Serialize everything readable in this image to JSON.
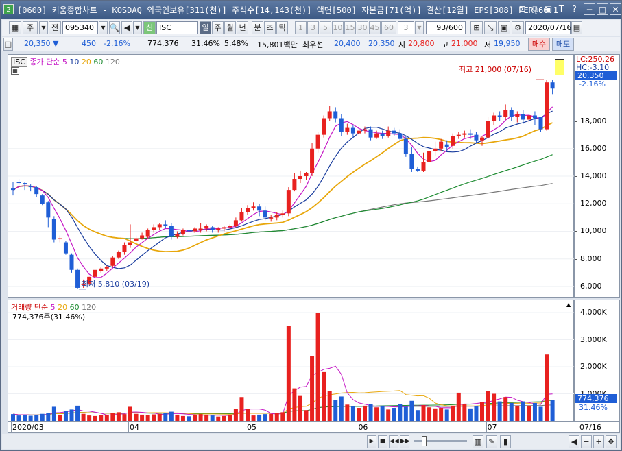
{
  "window": {
    "title": "[0600] 키움종합차트 - KOSDAQ 외국인보유[311(천)] 주식수[14,143(천)] 액면[500] 자본금[71(억)] 결산[12월] EPS[308] PER[66.1",
    "icon_label": "2",
    "buttons": [
      "⊡",
      "⧉",
      "▣",
      "T",
      "?",
      "─",
      "□",
      "✕"
    ]
  },
  "toolbar": {
    "period_label": "주",
    "prev_label": "전",
    "code_value": "095340",
    "sin_label": "신",
    "name_value": "ISC",
    "period_tabs": [
      "일",
      "주",
      "월",
      "년",
      "분",
      "초",
      "틱"
    ],
    "minute_tabs": [
      "1",
      "3",
      "5",
      "10",
      "15",
      "30",
      "45",
      "60"
    ],
    "custom_value": "3",
    "count_value": "93/600",
    "date_value": "2020/07/16"
  },
  "quote": {
    "price": "20,350",
    "arrow": "▼",
    "change": "450",
    "change_pct": "-2.16%",
    "volume": "774,376",
    "vol_ratio": "31.46%",
    "turnover": "5.48%",
    "amount": "15,801백만",
    "ask_label": "최우선",
    "ask": "20,400",
    "bid": "20,350",
    "open_label": "시",
    "open": "20,800",
    "high_label": "고",
    "high": "21,000",
    "low_label": "저",
    "low": "19,950",
    "buy_label": "매수",
    "sell_label": "매도"
  },
  "price_legend": {
    "symbol": "ISC",
    "label": "종가 단순",
    "periods": [
      "5",
      "10",
      "20",
      "60",
      "120"
    ]
  },
  "volume_legend": {
    "label": "거래량 단순",
    "periods": [
      "5",
      "20",
      "60",
      "120"
    ],
    "current": "774,376주(31.46%)"
  },
  "annotations": {
    "high": "최고 21,000 (07/16)",
    "low": "최저 5,810 (03/19)",
    "lc": "LC:250.26",
    "hc": "HC:-3.10"
  },
  "price_axis": {
    "ticks": [
      "18,000",
      "16,000",
      "14,000",
      "12,000",
      "10,000",
      "8,000",
      "6,000"
    ],
    "current": "20,350",
    "current_pct": "-2.16%"
  },
  "volume_axis": {
    "ticks": [
      "4,000K",
      "3,000K",
      "2,000K",
      "1,000K"
    ],
    "current": "774,376",
    "current_pct": "31.46%"
  },
  "x_axis": {
    "labels": [
      "2020/03",
      "04",
      "05",
      "06",
      "07"
    ],
    "right_label": "07/16"
  },
  "colors": {
    "up": "#e8211f",
    "down": "#1f5ed6",
    "ma5": "#c517c5",
    "ma10": "#1a3d9e",
    "ma20": "#e8a70c",
    "ma60": "#1e8c32",
    "ma120": "#777777"
  },
  "chart_data": {
    "type": "candlestick",
    "symbol": "ISC",
    "price_ylim": [
      5400,
      22500
    ],
    "volume_ylim": [
      0,
      4000000
    ],
    "candles": [
      [
        13100,
        13600,
        13000,
        12600
      ],
      [
        13600,
        13800,
        13500,
        13300
      ],
      [
        13500,
        13600,
        13400,
        13000
      ],
      [
        13300,
        13400,
        13200,
        12900
      ],
      [
        13200,
        13300,
        12700,
        12500
      ],
      [
        12600,
        12700,
        12000,
        11900
      ],
      [
        12100,
        12200,
        11000,
        10300
      ],
      [
        10900,
        11100,
        9400,
        9200
      ],
      [
        9500,
        9700,
        9500,
        9200
      ],
      [
        9200,
        9300,
        8400,
        8300
      ],
      [
        8300,
        8400,
        7200,
        7000
      ],
      [
        7200,
        7300,
        5900,
        5810
      ],
      [
        6100,
        6500,
        6200,
        5900
      ],
      [
        6200,
        6700,
        6700,
        6100
      ],
      [
        6700,
        7000,
        7200,
        6800
      ],
      [
        7100,
        7400,
        7300,
        7000
      ],
      [
        7300,
        7500,
        7400,
        7100
      ],
      [
        7500,
        8200,
        8100,
        7400
      ],
      [
        8100,
        8600,
        8500,
        8000
      ],
      [
        8500,
        9200,
        9000,
        8300
      ],
      [
        9000,
        10500,
        9200,
        8800
      ],
      [
        9300,
        9700,
        9500,
        9200
      ],
      [
        9500,
        9900,
        9700,
        9400
      ],
      [
        9600,
        10200,
        10100,
        9500
      ],
      [
        10100,
        10500,
        10300,
        9900
      ],
      [
        10300,
        10600,
        10500,
        10100
      ],
      [
        10500,
        10800,
        10400,
        10200
      ],
      [
        10400,
        10600,
        9600,
        9400
      ],
      [
        9600,
        10000,
        9800,
        9500
      ],
      [
        9800,
        10200,
        10100,
        9700
      ],
      [
        10100,
        10300,
        10000,
        9800
      ],
      [
        10000,
        10300,
        10200,
        9900
      ],
      [
        10100,
        10600,
        10200,
        9900
      ],
      [
        10200,
        10500,
        10400,
        10000
      ],
      [
        10300,
        10400,
        10100,
        9900
      ],
      [
        10100,
        10300,
        10200,
        9900
      ],
      [
        10200,
        10400,
        10300,
        10000
      ],
      [
        10300,
        10500,
        10400,
        10100
      ],
      [
        10400,
        11000,
        10800,
        10300
      ],
      [
        10800,
        11700,
        11400,
        10700
      ],
      [
        11400,
        11900,
        11700,
        11200
      ],
      [
        11700,
        12100,
        11800,
        11500
      ],
      [
        11800,
        12000,
        11500,
        11100
      ],
      [
        11500,
        11800,
        11000,
        10800
      ],
      [
        11000,
        11200,
        11000,
        10700
      ],
      [
        11000,
        11400,
        11200,
        10800
      ],
      [
        11200,
        11500,
        11300,
        11000
      ],
      [
        11300,
        13200,
        13000,
        11100
      ],
      [
        13000,
        14200,
        13800,
        12900
      ],
      [
        13800,
        14400,
        14000,
        13500
      ],
      [
        14000,
        14300,
        14200,
        13700
      ],
      [
        14200,
        16400,
        16000,
        14000
      ],
      [
        16000,
        17200,
        17000,
        15700
      ],
      [
        17000,
        18400,
        18200,
        16800
      ],
      [
        18200,
        19100,
        18700,
        18000
      ],
      [
        18700,
        19000,
        18200,
        17900
      ],
      [
        18200,
        18500,
        17200,
        16900
      ],
      [
        17200,
        17800,
        17500,
        17000
      ],
      [
        17500,
        17700,
        17100,
        16800
      ],
      [
        17100,
        17400,
        17300,
        16900
      ],
      [
        17300,
        17600,
        17400,
        17100
      ],
      [
        17400,
        17600,
        16800,
        16600
      ],
      [
        16800,
        17300,
        17100,
        16700
      ],
      [
        17100,
        17300,
        16900,
        16700
      ],
      [
        16900,
        17600,
        17300,
        16800
      ],
      [
        17300,
        17500,
        17100,
        16900
      ],
      [
        17100,
        17400,
        16700,
        16500
      ],
      [
        16700,
        16900,
        15600,
        15400
      ],
      [
        15600,
        16100,
        14500,
        14300
      ],
      [
        14500,
        14700,
        14400,
        14300
      ],
      [
        14400,
        15700,
        15000,
        14300
      ],
      [
        15000,
        15700,
        15800,
        15300
      ],
      [
        15800,
        16500,
        16000,
        15500
      ],
      [
        16000,
        16700,
        16500,
        15800
      ],
      [
        16300,
        16600,
        16100,
        15800
      ],
      [
        16200,
        17100,
        16900,
        16000
      ],
      [
        16900,
        17200,
        17000,
        16700
      ],
      [
        17000,
        17300,
        17100,
        16800
      ],
      [
        17100,
        17400,
        17000,
        16700
      ],
      [
        17000,
        17200,
        16600,
        16400
      ],
      [
        16600,
        16900,
        16800,
        16200
      ],
      [
        16800,
        18300,
        18000,
        16700
      ],
      [
        18000,
        18600,
        18400,
        17700
      ],
      [
        18400,
        18700,
        18300,
        18000
      ],
      [
        18300,
        19200,
        18800,
        18100
      ],
      [
        18800,
        19000,
        18300,
        18000
      ],
      [
        18300,
        18700,
        18500,
        17900
      ],
      [
        18500,
        18800,
        18100,
        17800
      ],
      [
        18100,
        18400,
        18400,
        17900
      ],
      [
        18400,
        18700,
        18200,
        17700
      ],
      [
        18300,
        18300,
        17400,
        17200
      ],
      [
        17400,
        21000,
        20800,
        17300
      ],
      [
        20800,
        21000,
        20350,
        19950
      ]
    ],
    "volumes": [
      250000,
      200000,
      230000,
      190000,
      220000,
      260000,
      300000,
      520000,
      230000,
      370000,
      420000,
      560000,
      260000,
      200000,
      180000,
      210000,
      230000,
      300000,
      320000,
      250000,
      520000,
      260000,
      230000,
      210000,
      240000,
      260000,
      280000,
      340000,
      230000,
      180000,
      170000,
      210000,
      250000,
      230000,
      200000,
      160000,
      180000,
      230000,
      450000,
      880000,
      440000,
      200000,
      230000,
      250000,
      260000,
      300000,
      320000,
      3500000,
      1200000,
      920000,
      400000,
      2400000,
      4000000,
      1800000,
      1100000,
      780000,
      900000,
      600000,
      540000,
      480000,
      560000,
      620000,
      500000,
      560000,
      420000,
      480000,
      620000,
      520000,
      740000,
      400000,
      580000,
      500000,
      460000,
      480000,
      420000,
      560000,
      1040000,
      620000,
      460000,
      540000,
      700000,
      1100000,
      1000000,
      720000,
      880000,
      660000,
      560000,
      720000,
      560000,
      660000,
      520000,
      2450000,
      774376
    ],
    "ma_series": [
      "5",
      "10",
      "20",
      "60",
      "120"
    ]
  }
}
